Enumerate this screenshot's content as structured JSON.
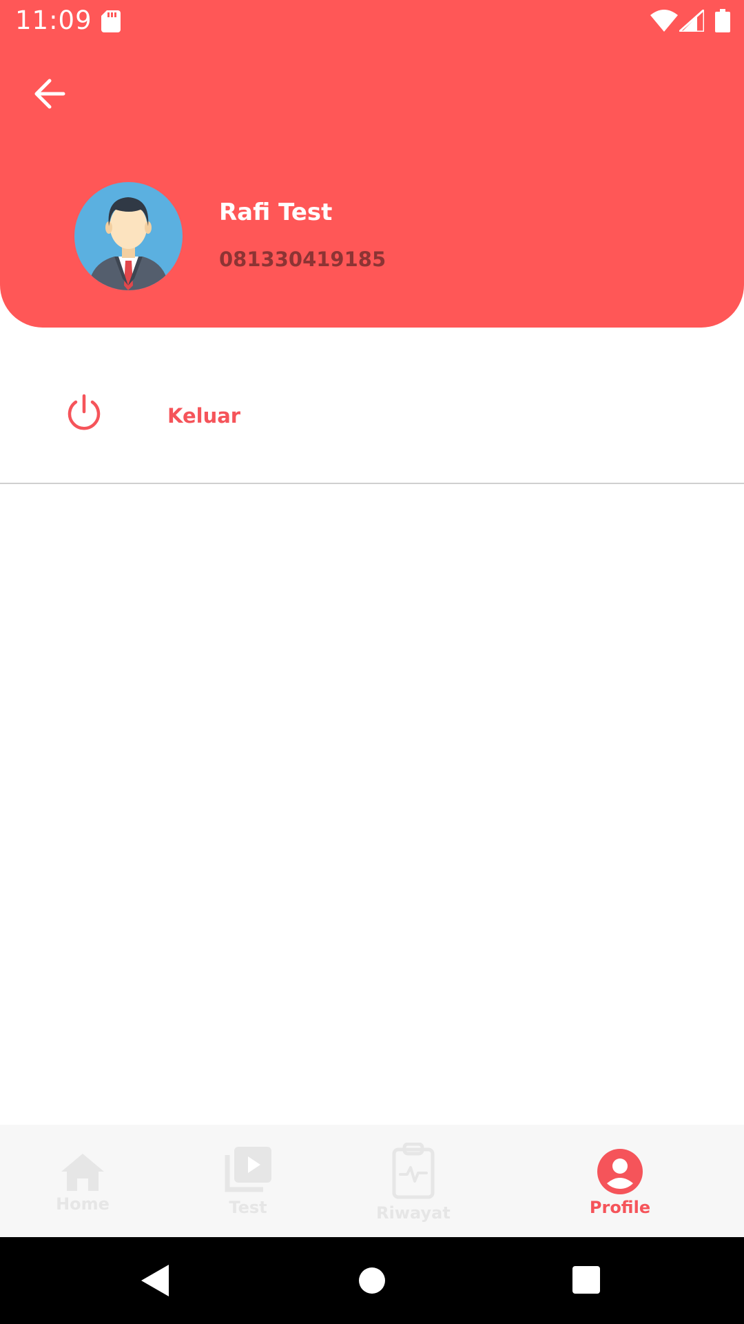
{
  "status_bar": {
    "time": "11:09"
  },
  "profile": {
    "name": "Rafi Test",
    "phone": "081330419185"
  },
  "menu": {
    "logout_label": "Keluar"
  },
  "bottom_nav": {
    "items": [
      {
        "label": "Home",
        "icon": "home-icon",
        "active": false
      },
      {
        "label": "Test",
        "icon": "video-library-icon",
        "active": false
      },
      {
        "label": "Riwayat",
        "icon": "clipboard-pulse-icon",
        "active": false
      },
      {
        "label": "Profile",
        "icon": "account-circle-icon",
        "active": true
      }
    ]
  },
  "colors": {
    "header_bg": "#FF5757",
    "accent": "#F5545A",
    "phone_text": "#8C3434",
    "nav_inactive": "#E6E6E6",
    "avatar_bg": "#5BB0E0"
  }
}
